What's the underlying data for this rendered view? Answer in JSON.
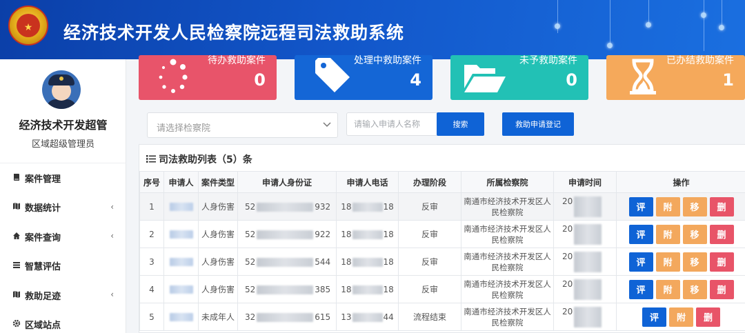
{
  "header": {
    "title": "经济技术开发人民检察院远程司法救助系统"
  },
  "user": {
    "name": "经济技术开发超管",
    "role": "区域超级管理员"
  },
  "menu": [
    {
      "label": "案件管理",
      "icon": "book-icon",
      "chevron": ""
    },
    {
      "label": "数据统计",
      "icon": "map-icon",
      "chevron": "‹"
    },
    {
      "label": "案件查询",
      "icon": "home-icon",
      "chevron": "‹"
    },
    {
      "label": "智慧评估",
      "icon": "list-icon",
      "chevron": ""
    },
    {
      "label": "救助足迹",
      "icon": "map-icon",
      "chevron": "‹"
    },
    {
      "label": "区域站点",
      "icon": "gear-icon",
      "chevron": ""
    }
  ],
  "cards": [
    {
      "label": "待办救助案件",
      "count": "0",
      "color": "#e8546a",
      "icon": "spinner-icon"
    },
    {
      "label": "处理中救助案件",
      "count": "4",
      "color": "#1466d6",
      "icon": "tag-icon"
    },
    {
      "label": "未予救助案件",
      "count": "0",
      "color": "#22c1b5",
      "icon": "folder-open-icon"
    },
    {
      "label": "已办结救助案件",
      "count": "1",
      "color": "#f5a95b",
      "icon": "hourglass-icon"
    }
  ],
  "search": {
    "procuratorate_placeholder": "请选择检察院",
    "applicant_placeholder": "请输入申请人名称",
    "search_label": "搜索",
    "register_label": "救助申请登记"
  },
  "table": {
    "title": "司法救助列表（5）条",
    "headers": [
      "序号",
      "申请人",
      "案件类型",
      "申请人身份证",
      "申请人电话",
      "办理阶段",
      "所属检察院",
      "申请时间",
      "操作"
    ],
    "rows": [
      {
        "no": "1",
        "type": "人身伤害",
        "id_prefix": "52",
        "id_suffix": "932",
        "phone_prefix": "18",
        "phone_suffix": "18",
        "stage": "反审",
        "org": "南通市经济技术开发区人民检察院",
        "time_prefix": "20",
        "actions": [
          "评",
          "附",
          "移",
          "删"
        ]
      },
      {
        "no": "2",
        "type": "人身伤害",
        "id_prefix": "52",
        "id_suffix": "922",
        "phone_prefix": "18",
        "phone_suffix": "18",
        "stage": "反审",
        "org": "南通市经济技术开发区人民检察院",
        "time_prefix": "20",
        "actions": [
          "评",
          "附",
          "移",
          "删"
        ]
      },
      {
        "no": "3",
        "type": "人身伤害",
        "id_prefix": "52",
        "id_suffix": "544",
        "phone_prefix": "18",
        "phone_suffix": "18",
        "stage": "反审",
        "org": "南通市经济技术开发区人民检察院",
        "time_prefix": "20",
        "actions": [
          "评",
          "附",
          "移",
          "删"
        ]
      },
      {
        "no": "4",
        "type": "人身伤害",
        "id_prefix": "52",
        "id_suffix": "385",
        "phone_prefix": "18",
        "phone_suffix": "18",
        "stage": "反审",
        "org": "南通市经济技术开发区人民检察院",
        "time_prefix": "20",
        "actions": [
          "评",
          "附",
          "移",
          "删"
        ]
      },
      {
        "no": "5",
        "type": "未成年人",
        "id_prefix": "32",
        "id_suffix": "615",
        "phone_prefix": "13",
        "phone_suffix": "44",
        "stage": "流程结束",
        "org": "南通市经济技术开发区人民检察院",
        "time_prefix": "20",
        "actions": [
          "评",
          "附",
          "删"
        ]
      }
    ]
  }
}
